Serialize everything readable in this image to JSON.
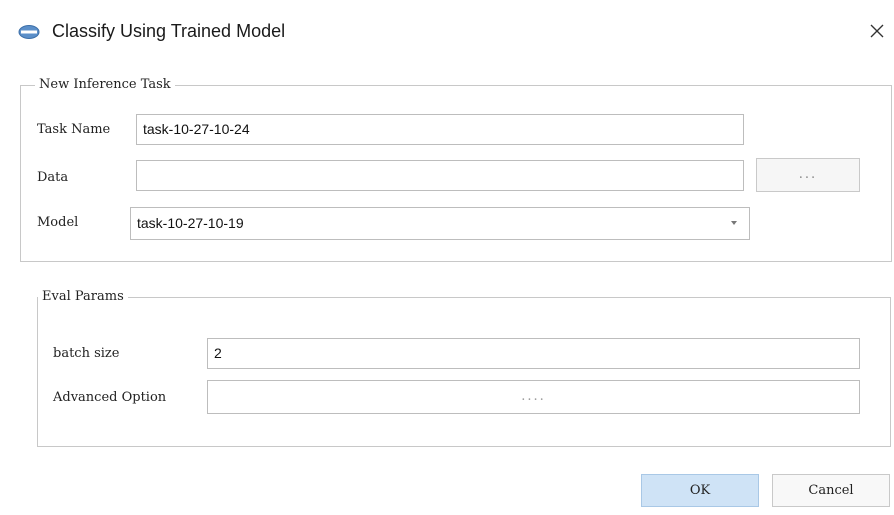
{
  "dialog": {
    "title": "Classify Using Trained Model",
    "icon": "app-logo-icon",
    "close_icon": "close-icon"
  },
  "inference_task": {
    "legend": "New Inference Task",
    "task_name_label": "Task Name",
    "task_name_value": "task-10-27-10-24",
    "data_label": "Data",
    "data_value": "",
    "browse_label": "...",
    "model_label": "Model",
    "model_value": "task-10-27-10-19"
  },
  "eval_params": {
    "legend": "Eval Params",
    "batch_size_label": "batch size",
    "batch_size_value": "2",
    "advanced_label": "Advanced Option",
    "advanced_button_label": "...."
  },
  "footer": {
    "ok_label": "OK",
    "cancel_label": "Cancel"
  },
  "colors": {
    "ok_button": "#cfe3f6",
    "border": "#c8c8c8"
  }
}
